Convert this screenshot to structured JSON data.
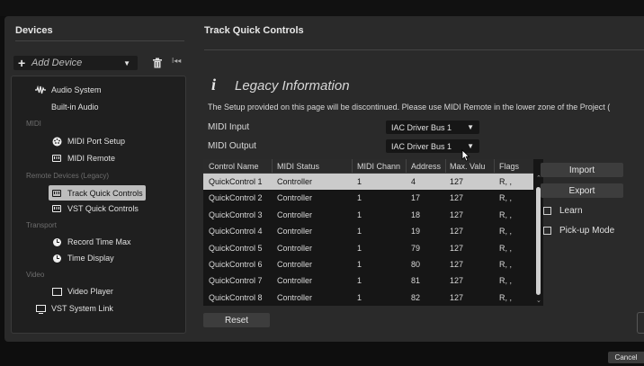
{
  "sidebar": {
    "title": "Devices",
    "add_device": "Add Device",
    "categories": {
      "midi": "MIDI",
      "remote": "Remote Devices (Legacy)",
      "transport": "Transport",
      "video": "Video"
    },
    "items": {
      "audio_system": "Audio System",
      "builtin_audio": "Built-in Audio",
      "midi_port_setup": "MIDI Port Setup",
      "midi_remote": "MIDI Remote",
      "track_quick_controls": "Track Quick Controls",
      "vst_quick_controls": "VST Quick Controls",
      "record_time_max": "Record Time Max",
      "time_display": "Time Display",
      "video_player": "Video Player",
      "vst_system_link": "VST System Link"
    }
  },
  "main": {
    "title": "Track Quick Controls",
    "legacy_icon": "i",
    "legacy_title": "Legacy Information",
    "legacy_text": "The Setup provided on this page will be discontinued. Please use MIDI Remote in the lower zone of the Project (",
    "midi_input_label": "MIDI Input",
    "midi_input_value": "IAC Driver Bus 1",
    "midi_output_label": "MIDI Output",
    "midi_output_value": "IAC Driver Bus 1"
  },
  "table": {
    "headers": [
      "Control Name",
      "MIDI Status",
      "MIDI Chann",
      "Address",
      "Max. Valu",
      "Flags"
    ],
    "rows": [
      [
        "QuickControl 1",
        "Controller",
        "1",
        "4",
        "127",
        "R, ,"
      ],
      [
        "QuickControl 2",
        "Controller",
        "1",
        "17",
        "127",
        "R, ,"
      ],
      [
        "QuickControl 3",
        "Controller",
        "1",
        "18",
        "127",
        "R, ,"
      ],
      [
        "QuickControl 4",
        "Controller",
        "1",
        "19",
        "127",
        "R, ,"
      ],
      [
        "QuickControl 5",
        "Controller",
        "1",
        "79",
        "127",
        "R, ,"
      ],
      [
        "QuickControl 6",
        "Controller",
        "1",
        "80",
        "127",
        "R, ,"
      ],
      [
        "QuickControl 7",
        "Controller",
        "1",
        "81",
        "127",
        "R, ,"
      ],
      [
        "QuickControl 8",
        "Controller",
        "1",
        "82",
        "127",
        "R, ,"
      ]
    ]
  },
  "buttons": {
    "import": "Import",
    "export": "Export",
    "reset": "Reset",
    "cancel": "Cancel"
  },
  "checks": {
    "learn": "Learn",
    "pickup": "Pick-up Mode"
  },
  "colors": {
    "selection": "#cbcbcb",
    "panel": "#2a2a2a"
  }
}
